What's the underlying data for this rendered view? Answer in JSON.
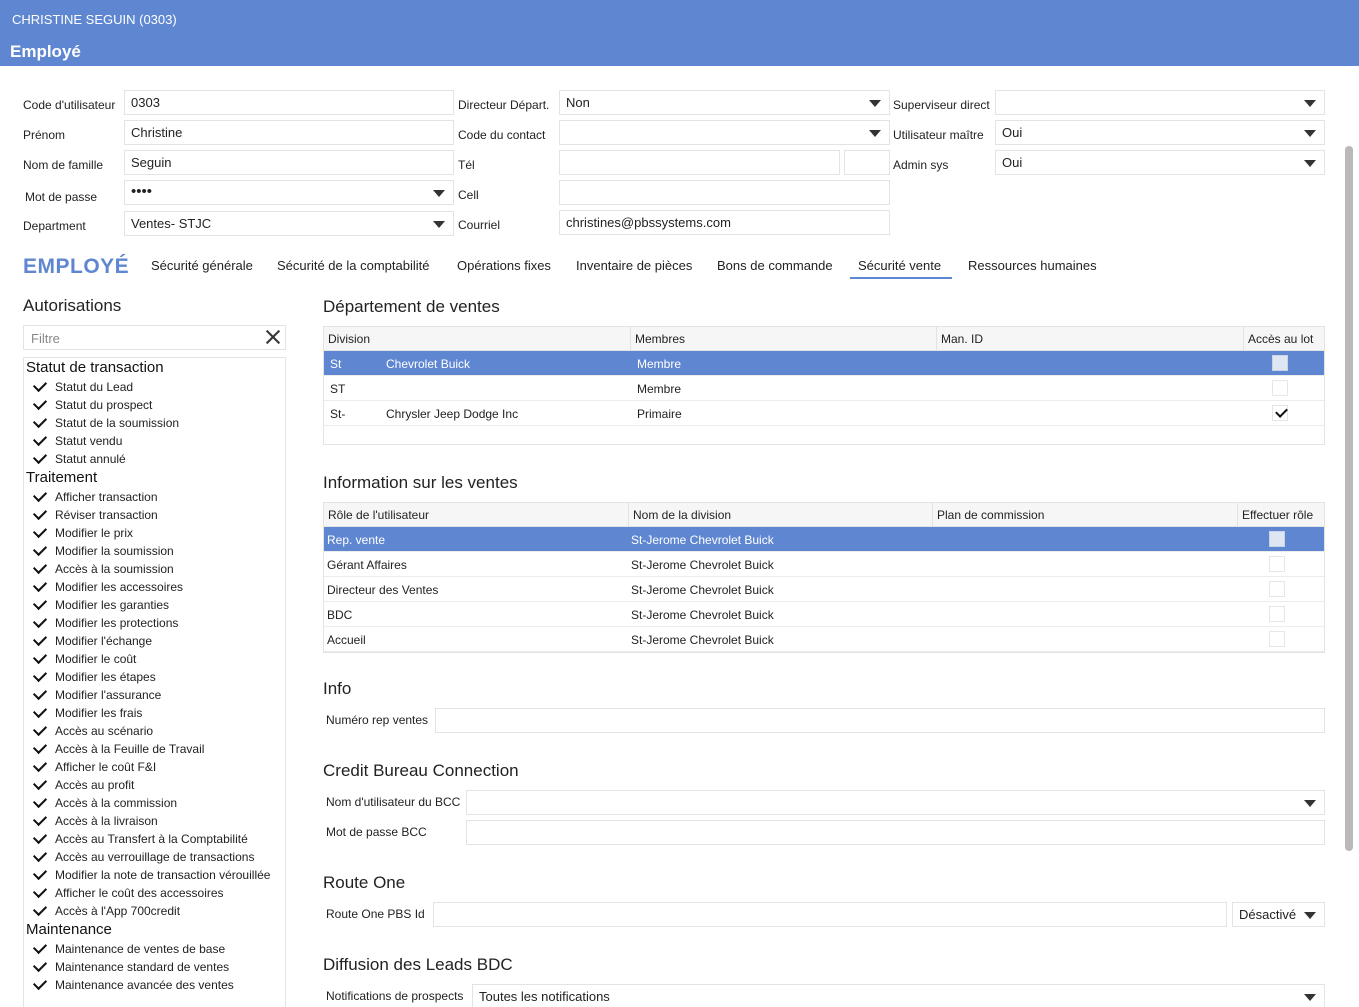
{
  "window": {
    "title": "CHRISTINE SEGUIN (0303)",
    "subtitle": "Employé"
  },
  "form": {
    "user_code": {
      "label": "Code d'utilisateur",
      "value": "0303"
    },
    "first_name": {
      "label": "Prénom",
      "value": "Christine"
    },
    "last_name": {
      "label": "Nom de famille",
      "value": "Seguin"
    },
    "password": {
      "label": "Mot de passe",
      "value": "••••"
    },
    "department": {
      "label": "Department",
      "value": "Ventes- STJC"
    },
    "dept_director": {
      "label": "Directeur Départ.",
      "value": "Non"
    },
    "contact_code": {
      "label": "Code du contact",
      "value": ""
    },
    "phone": {
      "label": "Tél",
      "value": "",
      "ext": ""
    },
    "cell": {
      "label": "Cell",
      "value": ""
    },
    "email": {
      "label": "Courriel",
      "value": "christines@pbssystems.com"
    },
    "direct_supervisor": {
      "label": "Superviseur direct",
      "value": ""
    },
    "master_user": {
      "label": "Utilisateur maître",
      "value": "Oui"
    },
    "admin_sys": {
      "label": "Admin sys",
      "value": "Oui"
    }
  },
  "tabs": {
    "logo": "EMPLOYÉ",
    "items": [
      "Sécurité générale",
      "Sécurité de la comptabilité",
      "Opérations fixes",
      "Inventaire de pièces",
      "Bons de commande",
      "Sécurité vente",
      "Ressources humaines"
    ],
    "active": "Sécurité vente"
  },
  "autorisations": {
    "title": "Autorisations",
    "filter_placeholder": "Filtre",
    "groups": [
      {
        "name": "Statut de transaction",
        "items": [
          "Statut du Lead",
          "Statut du prospect",
          "Statut de la soumission",
          "Statut vendu",
          "Statut annulé"
        ]
      },
      {
        "name": "Traitement",
        "items": [
          "Afficher transaction",
          "Réviser transaction",
          "Modifier le prix",
          "Modifier la soumission",
          "Accès à la soumission",
          "Modifier les accessoires",
          "Modifier les garanties",
          "Modifier les protections",
          "Modifier l'échange",
          "Modifier le coût",
          "Modifier les étapes",
          "Modifier l'assurance",
          "Modifier les frais",
          "Accès au scénario",
          "Accès à la Feuille de Travail",
          "Afficher le coût F&I",
          "Accès au profit",
          "Accès à la commission",
          "Accès à la livraison",
          "Accès au Transfert à la Comptabilité",
          "Accès au verrouillage de transactions",
          "Modifier la note de transaction vérouillée",
          "Afficher le coût des accessoires",
          "Accès à l'App 700credit"
        ]
      },
      {
        "name": "Maintenance",
        "items": [
          "Maintenance de ventes de base",
          "Maintenance standard de ventes",
          "Maintenance avancée des ventes"
        ]
      }
    ]
  },
  "sales_department": {
    "title": "Département de ventes",
    "columns": [
      "Division",
      "Membres",
      "Man. ID",
      "Accès au lot"
    ],
    "rows": [
      {
        "code": "St",
        "division": "Chevrolet Buick",
        "member": "Membre",
        "lot_access": false,
        "selected": true
      },
      {
        "code": "ST",
        "division": "",
        "member": "Membre",
        "lot_access": false,
        "selected": false
      },
      {
        "code": "St-",
        "division": "Chrysler Jeep Dodge Inc",
        "member": "Primaire",
        "lot_access": true,
        "selected": false
      }
    ]
  },
  "sales_info": {
    "title": "Information sur les ventes",
    "columns": [
      "Rôle de l'utilisateur",
      "Nom de la division",
      "Plan de commission",
      "Effectuer rôle"
    ],
    "rows": [
      {
        "role": "Rep. vente",
        "division": "St-Jerome Chevrolet Buick",
        "selected": true
      },
      {
        "role": "Gérant Affaires",
        "division": "St-Jerome Chevrolet Buick",
        "selected": false
      },
      {
        "role": "Directeur des Ventes",
        "division": "St-Jerome Chevrolet Buick",
        "selected": false
      },
      {
        "role": "BDC",
        "division": "St-Jerome Chevrolet Buick",
        "selected": false
      },
      {
        "role": "Accueil",
        "division": "St-Jerome Chevrolet Buick",
        "selected": false
      }
    ]
  },
  "info": {
    "title": "Info",
    "rep_number_label": "Numéro rep ventes",
    "rep_number_value": ""
  },
  "credit_bureau": {
    "title": "Credit Bureau Connection",
    "user_label": "Nom d'utilisateur du BCC",
    "user_value": "",
    "password_label": "Mot de passe BCC",
    "password_value": ""
  },
  "route_one": {
    "title": "Route One",
    "id_label": "Route One PBS Id",
    "id_value": "",
    "status": "Désactivé"
  },
  "bdc_leads": {
    "title": "Diffusion des Leads BDC",
    "notif_label": "Notifications de prospects",
    "notif_value": "Toutes les notifications"
  },
  "colors": {
    "accent": "#5f87d1"
  }
}
